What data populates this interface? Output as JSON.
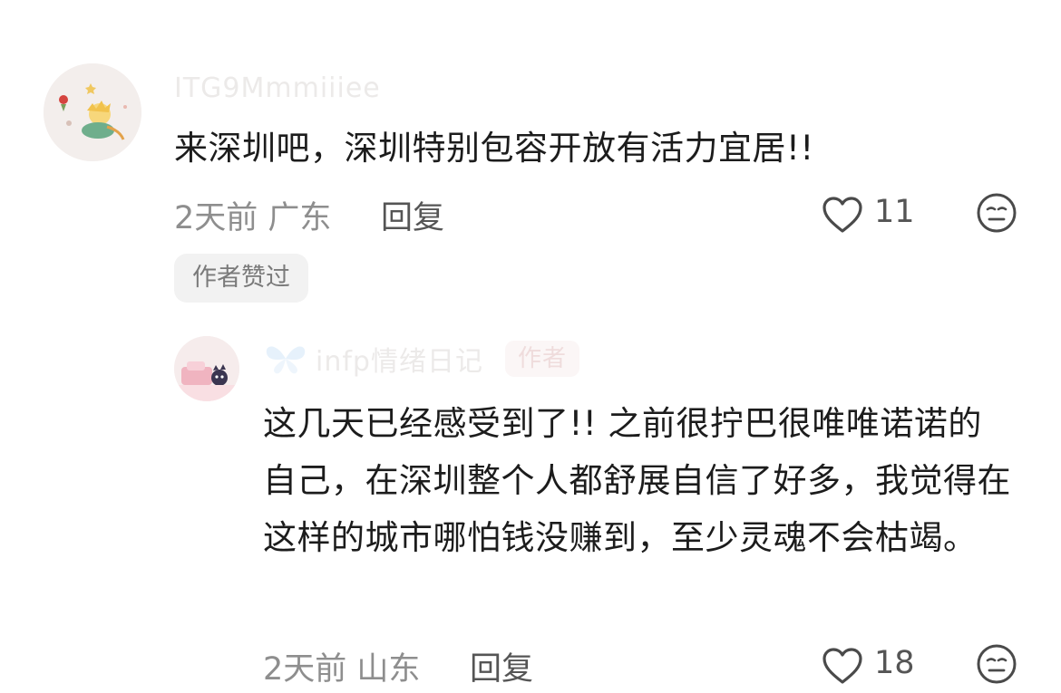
{
  "comments": [
    {
      "username": "ITG9Mmmiiiee",
      "text": "来深圳吧，深圳特别包容开放有活力宜居!!",
      "time_location": "2天前 广东",
      "reply_label": "回复",
      "like_count": "11",
      "author_liked": "作者赞过"
    },
    {
      "username": "infp情绪日记",
      "author_tag": "作者",
      "text": "这几天已经感受到了!! 之前很拧巴很唯唯诺诺的自己，在深圳整个人都舒展自信了好多，我觉得在这样的城市哪怕钱没赚到，至少灵魂不会枯竭。",
      "time_location": "2天前 山东",
      "reply_label": "回复",
      "like_count": "18"
    }
  ],
  "colors": {
    "text_primary": "#1c1c1c",
    "text_meta": "#8e8e8e",
    "tag_bg": "#f2f2f2",
    "faded_username": "#eceae9"
  },
  "icons": {
    "like": "heart-outline-icon",
    "emoji": "neutral-face-icon",
    "username_decoration": "butterfly-icon"
  }
}
